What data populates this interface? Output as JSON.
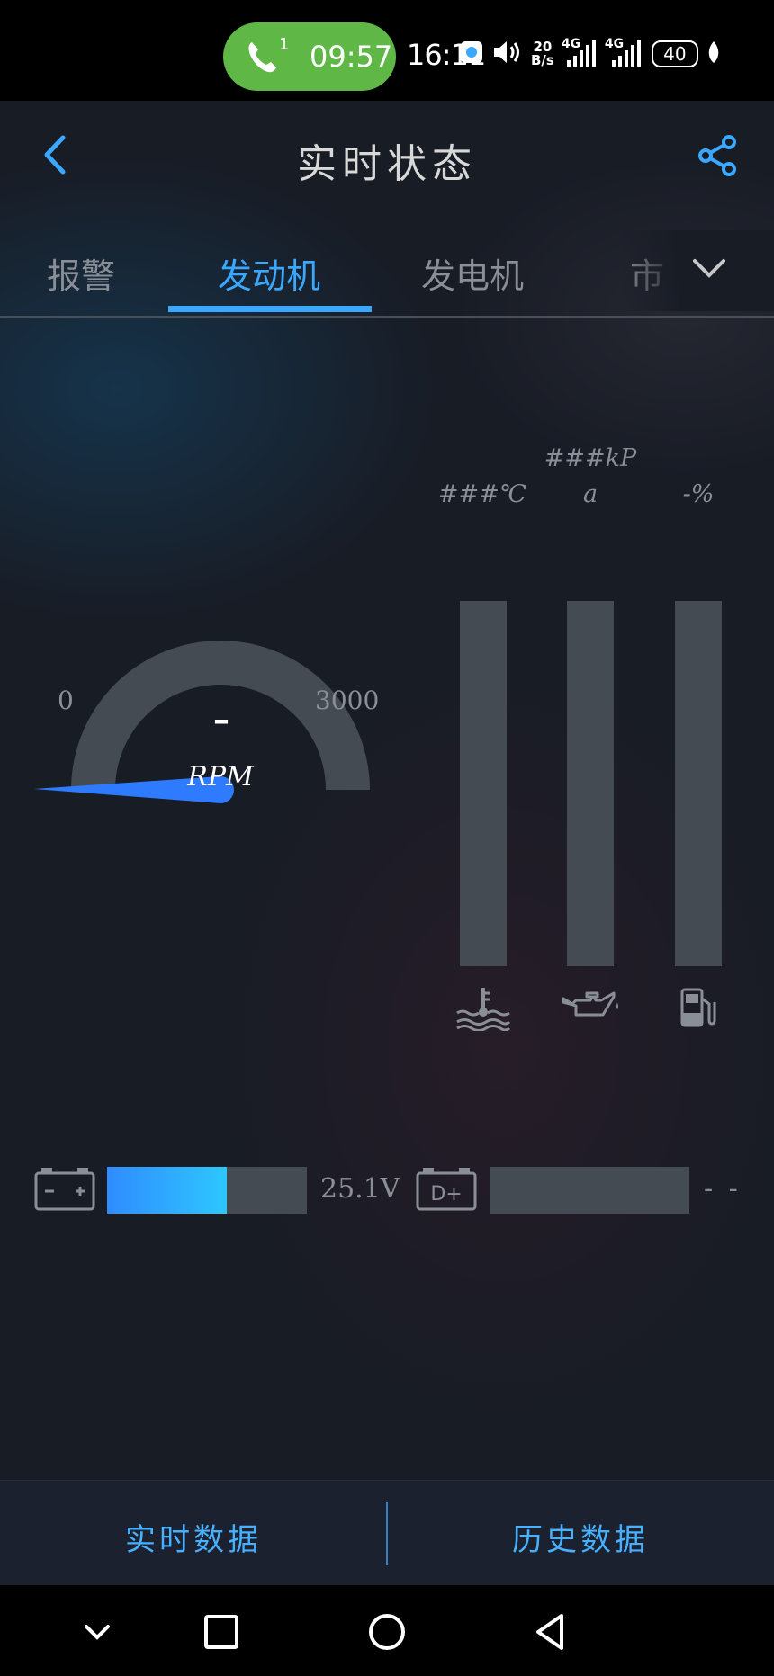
{
  "status_bar": {
    "call_count": "1",
    "call_time": "09:57",
    "time": "16:11",
    "net_speed_top": "20",
    "net_speed_bottom": "B/s",
    "sim1": "4G",
    "sim2": "4G",
    "battery": "40"
  },
  "header": {
    "title": "实时状态",
    "back_icon": "chevron-left-icon",
    "share_icon": "share-icon"
  },
  "tabs": {
    "items": [
      "报警",
      "发动机",
      "发电机",
      "市"
    ],
    "active_index": 1,
    "more_icon": "chevron-down-icon"
  },
  "gauge": {
    "min_label": "0",
    "max_label": "3000",
    "value": "–",
    "unit": "RPM",
    "fill_fraction": 0,
    "needle_color": "#2f7bff",
    "track_color": "#454b52"
  },
  "bars": [
    {
      "label_line1": "###℃",
      "label_line2": "",
      "fill_fraction": 0,
      "icon": "coolant-temperature-icon"
    },
    {
      "label_line1": "###kP",
      "label_line2": "a",
      "fill_fraction": 0,
      "icon": "oil-pressure-icon"
    },
    {
      "label_line1": "-%",
      "label_line2": "",
      "fill_fraction": 0,
      "icon": "fuel-pump-icon"
    }
  ],
  "battery_row": {
    "icon": "battery-icon",
    "value": "25.1V",
    "fill_fraction": 0.6
  },
  "dplus_row": {
    "icon_label": "D+",
    "value": "- -",
    "fill_fraction": 0
  },
  "bottom": {
    "left_label": "实时数据",
    "right_label": "历史数据"
  },
  "nav": {
    "icons": [
      "chevron-down-icon",
      "square-icon",
      "circle-icon",
      "triangle-back-icon"
    ]
  },
  "colors": {
    "accent": "#3aa8ff",
    "bar_track": "#454b52",
    "call_pill": "#5fb846"
  }
}
